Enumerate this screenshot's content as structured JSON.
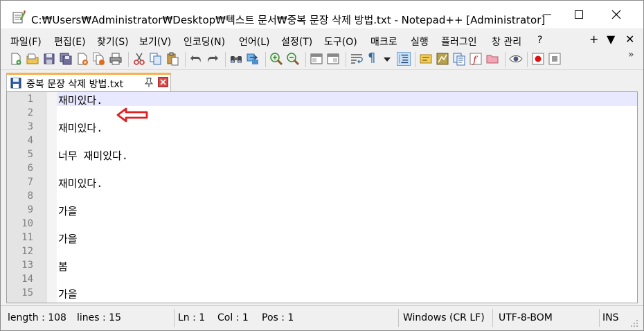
{
  "window": {
    "title": "C:₩Users₩Administrator₩Desktop₩텍스트 문서₩중복 문장 삭제 방법.txt - Notepad++ [Administrator]"
  },
  "menu": {
    "items": [
      "파일(F)",
      "편집(E)",
      "찾기(S)",
      "보기(V)",
      "인코딩(N)",
      "언어(L)",
      "설정(T)",
      "도구(O)",
      "매크로",
      "실행",
      "플러그인",
      "창 관리",
      "?"
    ],
    "right": [
      "+",
      "▼",
      "✕"
    ]
  },
  "toolbar": {
    "icons": [
      "new-file-icon",
      "open-file-icon",
      "save-icon",
      "save-all-icon",
      "close-icon",
      "close-all-icon",
      "print-icon",
      "cut-icon",
      "copy-icon",
      "paste-icon",
      "undo-icon",
      "redo-icon",
      "find-icon",
      "replace-icon",
      "zoom-in-icon",
      "zoom-out-icon",
      "sync-v-icon",
      "sync-h-icon",
      "wrap-icon",
      "show-all-chars-icon",
      "indent-guide-icon",
      "lang-icon",
      "doc-map-icon",
      "func-list-icon",
      "folder-icon",
      "monitor-icon",
      "record-macro-icon",
      "stop-macro-icon"
    ],
    "overflow": "»"
  },
  "tab": {
    "label": "중복 문장 삭제 방법.txt",
    "pin_glyph": "⚲"
  },
  "editor": {
    "lines": [
      {
        "num": "1",
        "text": "재미있다."
      },
      {
        "num": "2",
        "text": ""
      },
      {
        "num": "3",
        "text": "재미있다."
      },
      {
        "num": "4",
        "text": ""
      },
      {
        "num": "5",
        "text": "너무 재미있다."
      },
      {
        "num": "6",
        "text": ""
      },
      {
        "num": "7",
        "text": "재미있다."
      },
      {
        "num": "8",
        "text": ""
      },
      {
        "num": "9",
        "text": "가을"
      },
      {
        "num": "10",
        "text": ""
      },
      {
        "num": "11",
        "text": "가을"
      },
      {
        "num": "12",
        "text": ""
      },
      {
        "num": "13",
        "text": "봄"
      },
      {
        "num": "14",
        "text": ""
      },
      {
        "num": "15",
        "text": "가을"
      }
    ],
    "current_line": 1
  },
  "status": {
    "length": "length : 108",
    "lines": "lines : 15",
    "ln": "Ln : 1",
    "col": "Col : 1",
    "pos": "Pos : 1",
    "eol": "Windows (CR LF)",
    "encoding": "UTF-8-BOM",
    "mode": "INS"
  },
  "colors": {
    "current_line": "#e8e8ff",
    "gutter": "#e4e4e4",
    "tab_accent": "#fbae4b",
    "arrow": "#e02020"
  }
}
